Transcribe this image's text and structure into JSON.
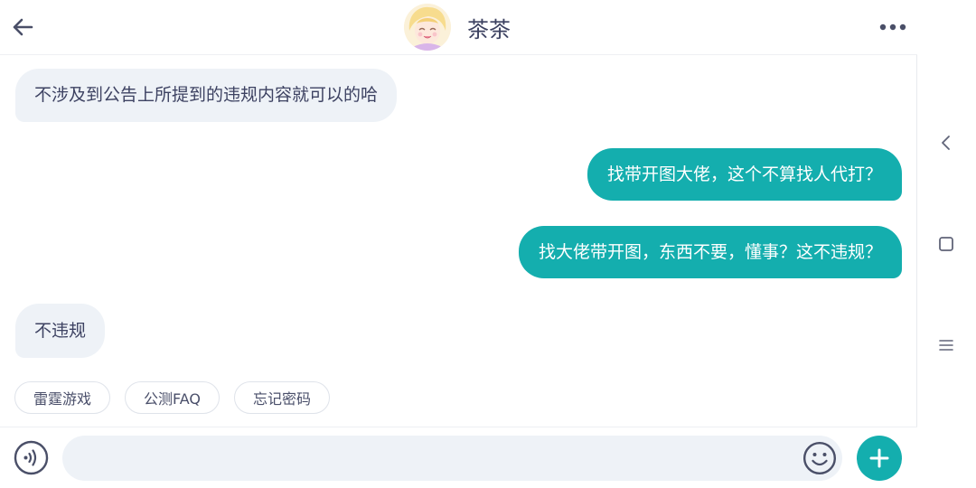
{
  "header": {
    "title": "茶茶"
  },
  "messages": [
    {
      "side": "in",
      "text": "不涉及到公告上所提到的违规内容就可以的哈"
    },
    {
      "side": "out",
      "text": "找带开图大佬，这个不算找人代打？"
    },
    {
      "side": "out",
      "text": "找大佬带开图，东西不要，懂事？这不违规？"
    },
    {
      "side": "in",
      "text": "不违规"
    }
  ],
  "quick_replies": [
    "雷霆游戏",
    "公测FAQ",
    "忘记密码"
  ],
  "input": {
    "value": "",
    "placeholder": ""
  },
  "colors": {
    "accent": "#14aeae",
    "incoming_bubble": "#eef2f7",
    "title_text": "#3c4160"
  },
  "icons": {
    "back": "arrow-left-icon",
    "more": "more-dots-icon",
    "voice": "voice-icon",
    "emoji": "emoji-icon",
    "plus": "plus-icon",
    "sys_back": "chevron-left-icon",
    "sys_home": "square-icon",
    "sys_menu": "menu-lines-icon"
  }
}
